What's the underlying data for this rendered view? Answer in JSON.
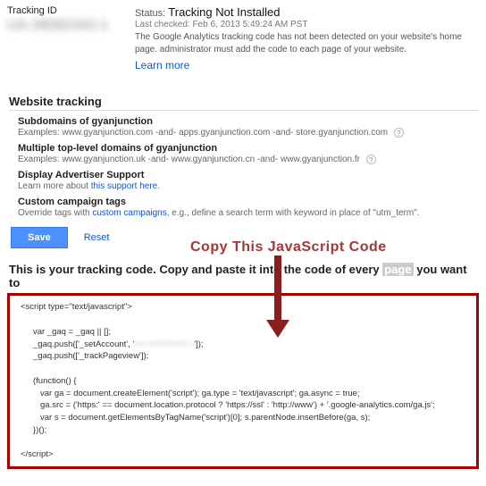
{
  "header": {
    "tracking_id_label": "Tracking ID",
    "tracking_id_value": "UA-38082343-1",
    "status_label": "Status:",
    "status_value": "Tracking Not Installed",
    "last_checked": "Last checked: Feb 6, 2013 5:49:24 AM PST",
    "status_desc": "The Google Analytics tracking code has not been detected on your website's home page. administrator must add the code to each page of your website.",
    "learn_more": "Learn more"
  },
  "tracking": {
    "section_title": "Website tracking",
    "sub1_title": "Subdomains of gyanjunction",
    "sub1_desc_pre": "Examples: www.gyanjunction.com -and- apps.gyanjunction.com -and- store.gyanjunction.com",
    "sub2_title": "Multiple top-level domains of gyanjunction",
    "sub2_desc": "Examples: www.gyanjunction.uk -and- www.gyanjunction.cn -and- www.gyanjunction.fr",
    "sub3_title": "Display Advertiser Support",
    "sub3_desc_pre": "Learn more about ",
    "sub3_link": "this support here",
    "sub4_title": "Custom campaign tags",
    "sub4_desc_pre": "Override tags with ",
    "sub4_link": "custom campaigns",
    "sub4_desc_post": ", e.g., define a search term with keyword in place of \"utm_term\".",
    "save_label": "Save",
    "reset_label": "Reset"
  },
  "code": {
    "heading_pre": "This is your tracking code. Copy and paste it into the code of every ",
    "heading_hl": "page",
    "heading_post": " you want to",
    "l1": "<script type=\"text/javascript\">",
    "l2": "var _gaq = _gaq || [];",
    "l3a": "_gaq.push(['_setAccount', '",
    "l3b_blur": "UA-00000000-0",
    "l3c": "']);",
    "l4": "_gaq.push(['_trackPageview']);",
    "l5": "(function() {",
    "l6": "var ga = document.createElement('script'); ga.type = 'text/javascript'; ga.async = true;",
    "l7": "ga.src = ('https:' == document.location.protocol ? 'https://ssl' : 'http://www') + '.google-analytics.com/ga.js';",
    "l8": "var s = document.getElementsByTagName('script')[0]; s.parentNode.insertBefore(ga, s);",
    "l9": "})();",
    "l10": "</script>"
  },
  "annotation": {
    "text": "Copy This JavaScript Code"
  },
  "help_glyph": "?"
}
